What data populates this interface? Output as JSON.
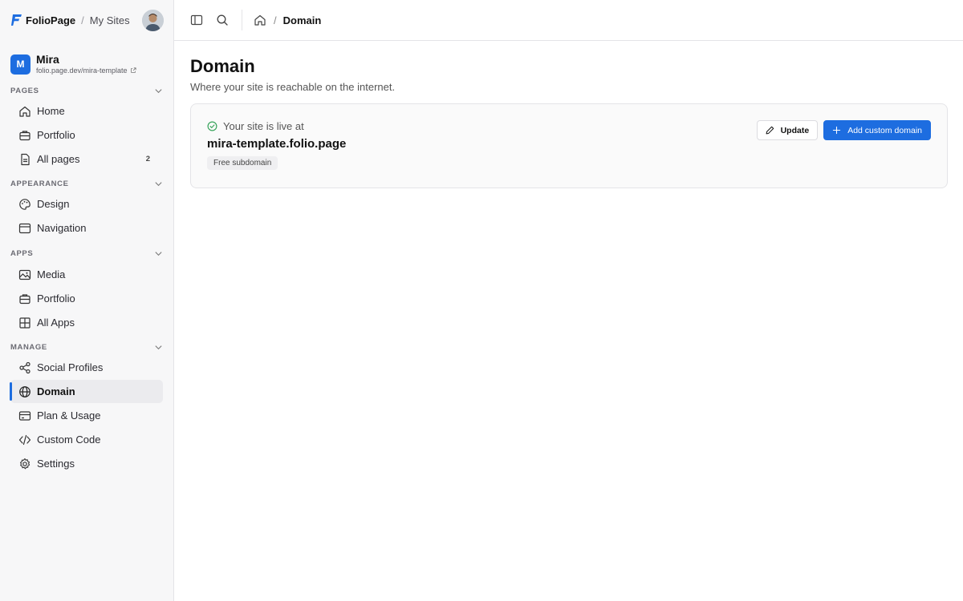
{
  "brand": {
    "name": "FolioPage",
    "separator": "/",
    "my_sites": "My Sites"
  },
  "site": {
    "initial": "M",
    "name": "Mira",
    "url": "folio.page.dev/mira-template"
  },
  "sidebar": {
    "sections": [
      {
        "title": "PAGES",
        "items": [
          {
            "label": "Home",
            "icon": "home-icon"
          },
          {
            "label": "Portfolio",
            "icon": "briefcase-icon"
          },
          {
            "label": "All pages",
            "icon": "pages-icon",
            "count": "2"
          }
        ]
      },
      {
        "title": "APPEARANCE",
        "items": [
          {
            "label": "Design",
            "icon": "palette-icon"
          },
          {
            "label": "Navigation",
            "icon": "window-icon"
          }
        ]
      },
      {
        "title": "APPS",
        "items": [
          {
            "label": "Media",
            "icon": "image-icon"
          },
          {
            "label": "Portfolio",
            "icon": "briefcase-icon"
          },
          {
            "label": "All Apps",
            "icon": "grid-icon"
          }
        ]
      },
      {
        "title": "MANAGE",
        "items": [
          {
            "label": "Social Profiles",
            "icon": "share-icon"
          },
          {
            "label": "Domain",
            "icon": "globe-icon",
            "active": true
          },
          {
            "label": "Plan & Usage",
            "icon": "card-icon"
          },
          {
            "label": "Custom Code",
            "icon": "code-icon"
          },
          {
            "label": "Settings",
            "icon": "gear-icon"
          }
        ]
      }
    ]
  },
  "breadcrumb": {
    "separator": "/",
    "current": "Domain"
  },
  "page": {
    "title": "Domain",
    "subtitle": "Where your site is reachable on the internet."
  },
  "domain_card": {
    "status_text": "Your site is live at",
    "domain": "mira-template.folio.page",
    "tag": "Free subdomain",
    "update_label": "Update",
    "add_label": "Add custom domain"
  },
  "colors": {
    "accent": "#1d6de0",
    "success": "#3aa55d"
  }
}
